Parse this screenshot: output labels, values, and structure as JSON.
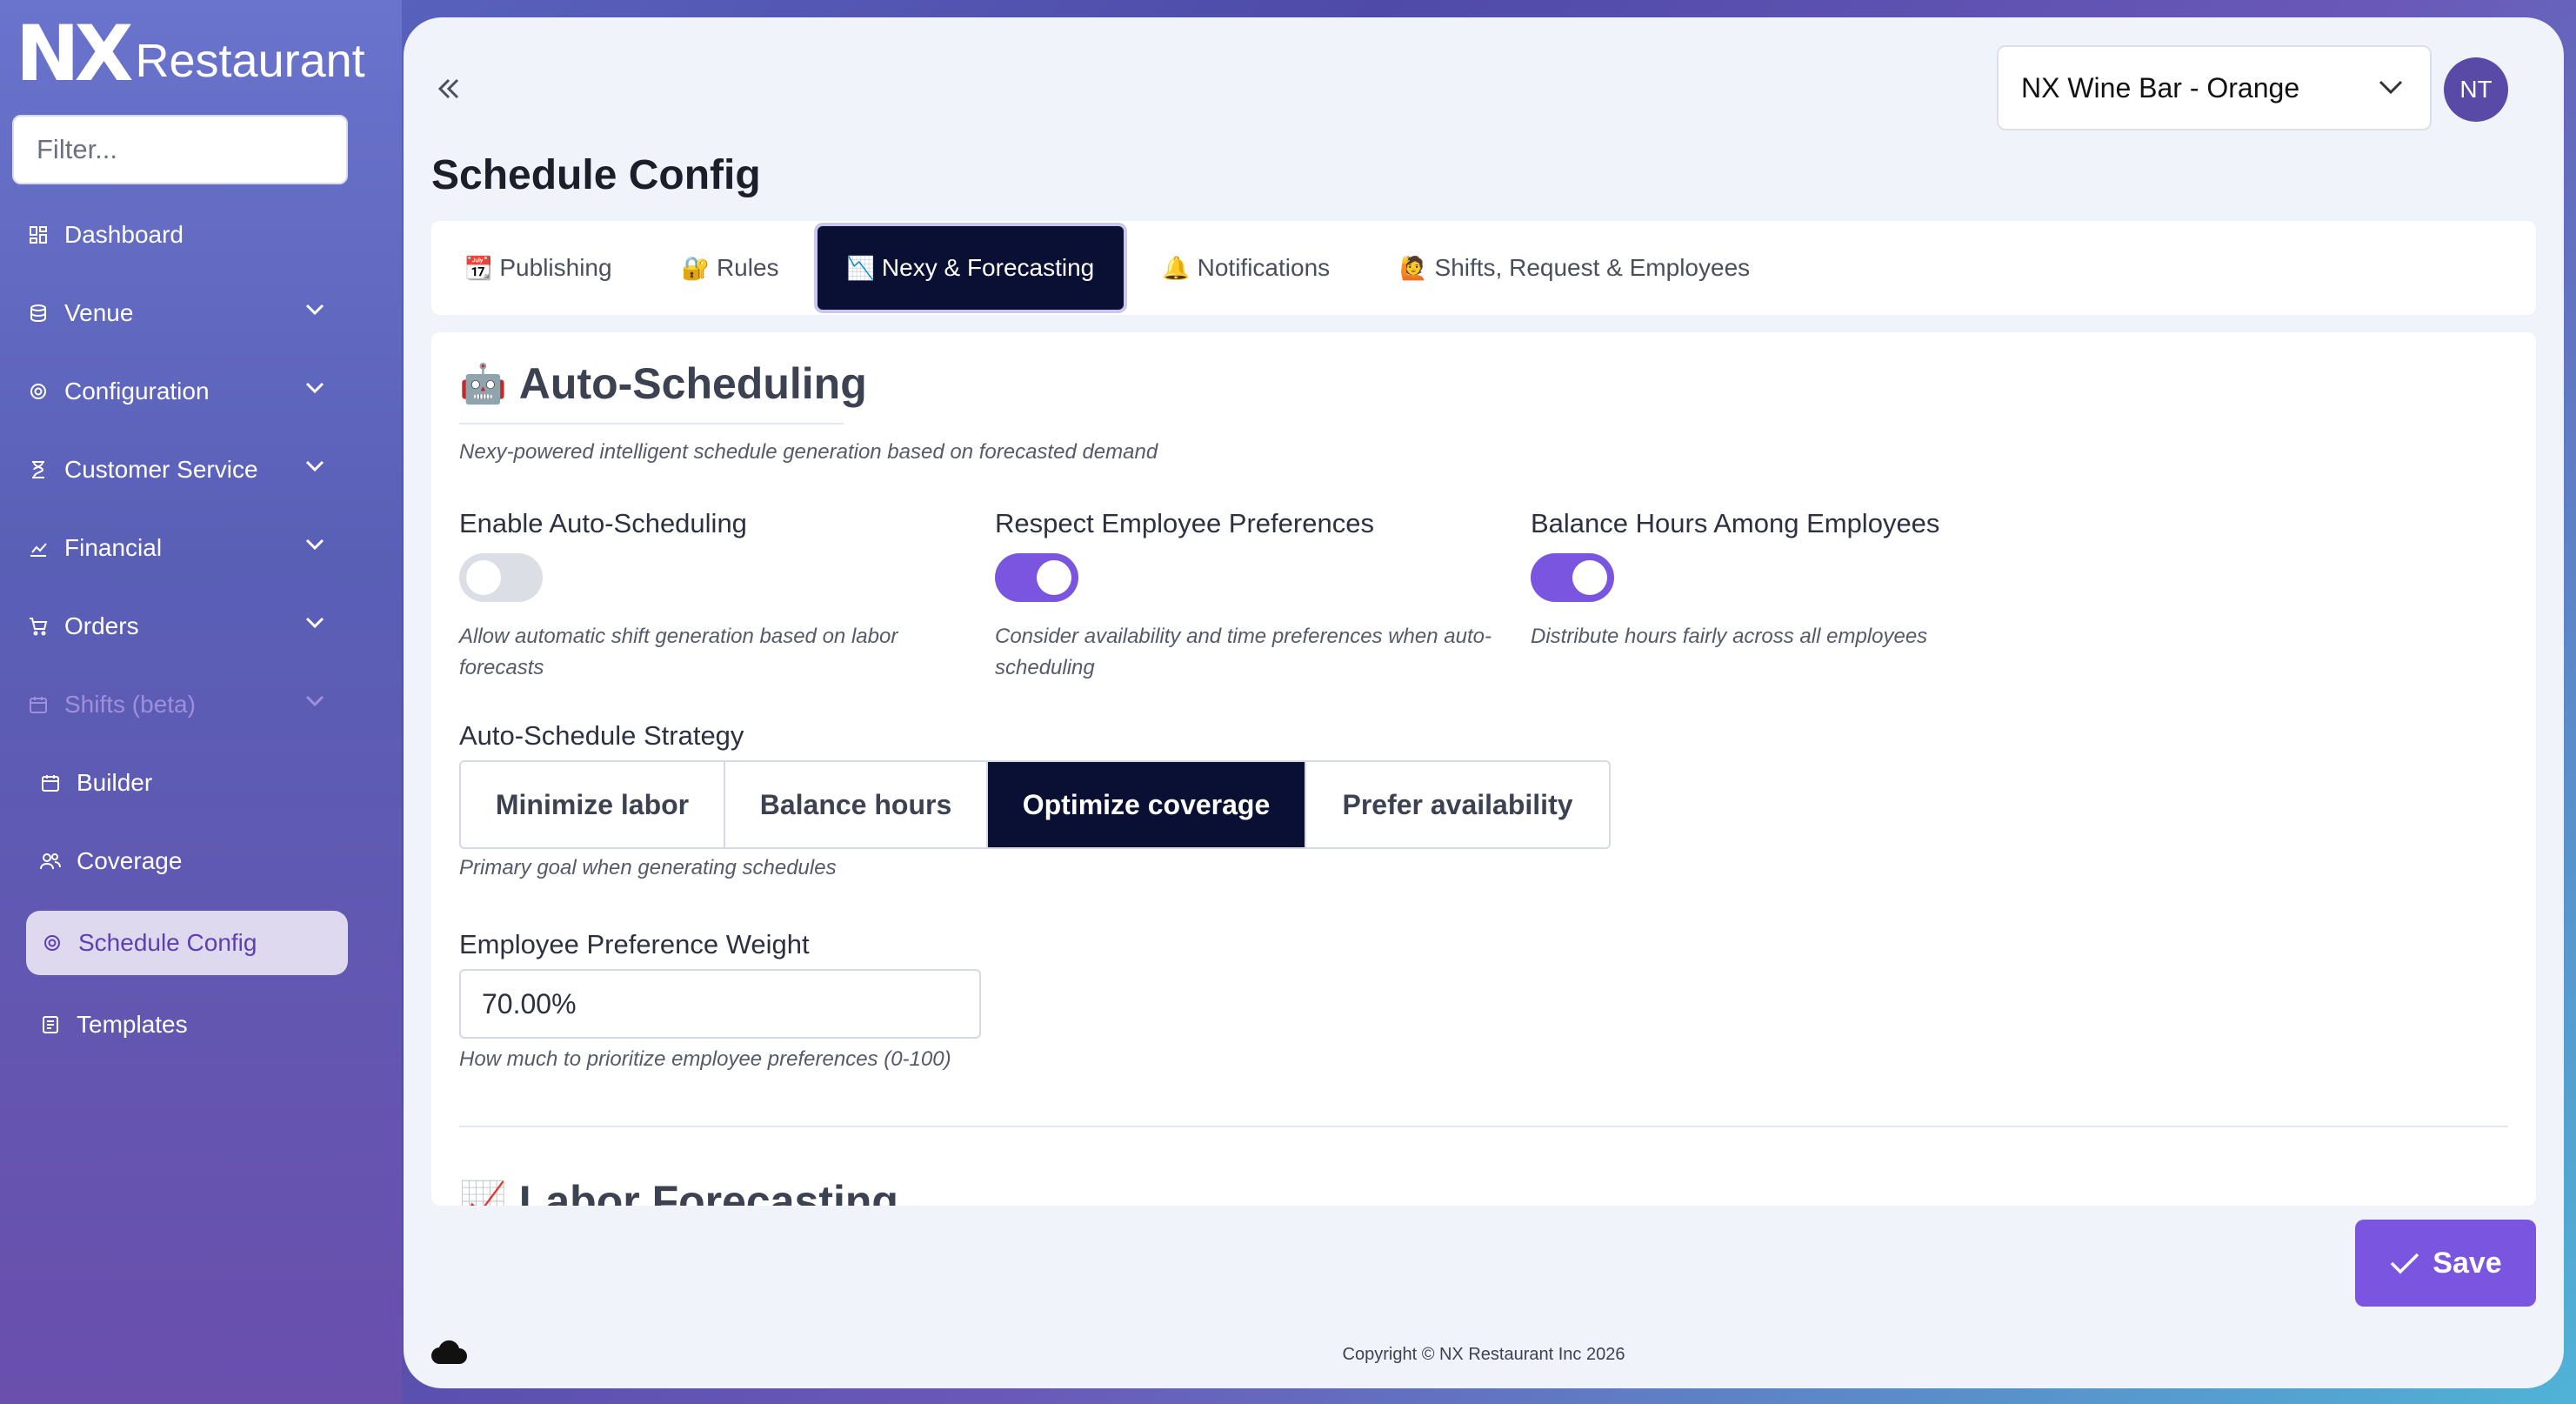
{
  "brand": {
    "logo_mark": "NX",
    "logo_text": "Restaurant"
  },
  "sidebar": {
    "filter_placeholder": "Filter...",
    "items": [
      {
        "label": "Dashboard",
        "icon": "dashboard-icon",
        "expandable": false
      },
      {
        "label": "Venue",
        "icon": "venue-icon",
        "expandable": true
      },
      {
        "label": "Configuration",
        "icon": "gear-icon",
        "expandable": true
      },
      {
        "label": "Customer Service",
        "icon": "hourglass-icon",
        "expandable": true
      },
      {
        "label": "Financial",
        "icon": "chart-icon",
        "expandable": true
      },
      {
        "label": "Orders",
        "icon": "cart-icon",
        "expandable": true
      },
      {
        "label": "Shifts (beta)",
        "icon": "calendar-icon",
        "expandable": true,
        "expanded": true
      }
    ],
    "sub_items": [
      {
        "label": "Builder",
        "icon": "calendar-icon"
      },
      {
        "label": "Coverage",
        "icon": "users-icon"
      },
      {
        "label": "Schedule Config",
        "icon": "gear-icon",
        "active": true
      },
      {
        "label": "Templates",
        "icon": "template-icon"
      }
    ]
  },
  "header": {
    "venue": "NX Wine Bar - Orange",
    "avatar_initials": "NT",
    "page_title": "Schedule Config"
  },
  "tabs": [
    {
      "emoji": "📆",
      "label": "Publishing"
    },
    {
      "emoji": "🔐",
      "label": "Rules"
    },
    {
      "emoji": "📉",
      "label": "Nexy & Forecasting",
      "active": true
    },
    {
      "emoji": "🔔",
      "label": "Notifications"
    },
    {
      "emoji": "🙋",
      "label": "Shifts, Request & Employees"
    }
  ],
  "auto_scheduling": {
    "emoji": "🤖",
    "title": "Auto-Scheduling",
    "description": "Nexy-powered intelligent schedule generation based on forecasted demand",
    "toggles": [
      {
        "label": "Enable Auto-Scheduling",
        "on": false,
        "help": "Allow automatic shift generation based on labor forecasts"
      },
      {
        "label": "Respect Employee Preferences",
        "on": true,
        "help": "Consider availability and time preferences when auto-scheduling"
      },
      {
        "label": "Balance Hours Among Employees",
        "on": true,
        "help": "Distribute hours fairly across all employees"
      }
    ],
    "strategy": {
      "label": "Auto-Schedule Strategy",
      "options": [
        "Minimize labor",
        "Balance hours",
        "Optimize coverage",
        "Prefer availability"
      ],
      "selected": "Optimize coverage",
      "help": "Primary goal when generating schedules"
    },
    "preference_weight": {
      "label": "Employee Preference Weight",
      "value": "70.00%",
      "help": "How much to prioritize employee preferences (0-100)"
    }
  },
  "next_section": {
    "emoji": "📈",
    "title": "Labor Forecasting"
  },
  "actions": {
    "save_label": "Save"
  },
  "footer": {
    "copyright": "Copyright © NX Restaurant Inc 2026"
  },
  "colors": {
    "accent": "#7a55e0",
    "active_dark": "#0a1033",
    "avatar": "#5a4aa8"
  }
}
